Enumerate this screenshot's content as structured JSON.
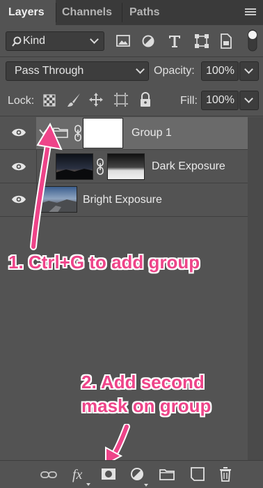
{
  "tabs": [
    {
      "label": "Layers",
      "active": true
    },
    {
      "label": "Channels",
      "active": false
    },
    {
      "label": "Paths",
      "active": false
    }
  ],
  "filter": {
    "kind_label": "Kind"
  },
  "blend": {
    "mode": "Pass Through",
    "opacity_label": "Opacity:",
    "opacity_value": "100%"
  },
  "lock": {
    "label": "Lock:",
    "fill_label": "Fill:",
    "fill_value": "100%"
  },
  "layers": [
    {
      "name": "Group 1",
      "type": "group",
      "selected": true
    },
    {
      "name": "Dark Exposure",
      "type": "image-with-mask"
    },
    {
      "name": "Bright Exposure",
      "type": "image"
    }
  ],
  "annotations": {
    "step1": "1. Ctrl+G to add group",
    "step2_line1": "2. Add second",
    "step2_line2": "mask on group"
  },
  "colors": {
    "panel": "#535353",
    "tabbar": "#3a3a3a",
    "selected_row": "#6a6a6a",
    "annotation": "#ee4489"
  },
  "bottom_icons": [
    "link-icon",
    "fx-icon",
    "add-mask-icon",
    "adjustment-layer-icon",
    "new-group-icon",
    "new-layer-icon",
    "trash-icon"
  ]
}
